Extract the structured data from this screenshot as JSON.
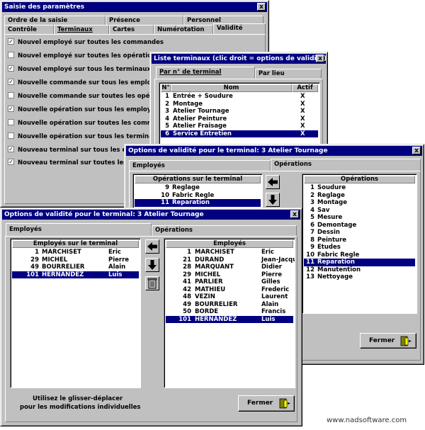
{
  "win1": {
    "title": "Saisie des paramètres",
    "close": "x",
    "tabs_row1": [
      "Ordre de la saisie",
      "Présence",
      "Personnel"
    ],
    "tabs_row2": [
      "Contrôle",
      "Terminaux",
      "Cartes",
      "Numérotation",
      "Validité"
    ],
    "checks": [
      {
        "label": "Nouvel employé sur toutes les commandes",
        "checked": true
      },
      {
        "label": "Nouvel employé sur toutes les opérations",
        "checked": false
      },
      {
        "label": "Nouvel employé sur tous les terminaux",
        "checked": true
      },
      {
        "label": "Nouvelle commande sur tous les employés",
        "checked": true
      },
      {
        "label": "Nouvelle commande sur toutes les opérations",
        "checked": false
      },
      {
        "label": "Nouvelle opération sur tous les employés",
        "checked": true
      },
      {
        "label": "Nouvelle opération sur toutes les commandes",
        "checked": false
      },
      {
        "label": "Nouvelle opération sur tous les terminaux",
        "checked": false
      },
      {
        "label": "Nouveau terminal sur tous les employés",
        "checked": true
      },
      {
        "label": "Nouveau terminal sur toutes les opérations",
        "checked": true
      }
    ]
  },
  "win2": {
    "title": "Liste terminaux  (clic droit = options de validité)",
    "close": "x",
    "tabs": [
      "Par n° de terminal",
      "Par lieu"
    ],
    "headers": [
      "N°",
      "Nom",
      "Actif"
    ],
    "rows": [
      {
        "n": "1",
        "nom": "Entrée + Soudure",
        "actif": "X"
      },
      {
        "n": "2",
        "nom": "Montage",
        "actif": "X"
      },
      {
        "n": "3",
        "nom": "Atelier Tournage",
        "actif": "X"
      },
      {
        "n": "4",
        "nom": "Atelier Peinture",
        "actif": "X"
      },
      {
        "n": "5",
        "nom": "Atelier Fraisage",
        "actif": "X"
      },
      {
        "n": "6",
        "nom": "Service Entretien",
        "actif": "X"
      }
    ]
  },
  "win3": {
    "title": "Options de validité pour le terminal: 3 Atelier Tournage",
    "close": "x",
    "tabs": [
      "Employés",
      "Opérations"
    ],
    "left_header": "Opérations sur le terminal",
    "left_rows": [
      {
        "n": "9",
        "name": "Reglage"
      },
      {
        "n": "10",
        "name": "Fabric Regle"
      },
      {
        "n": "11",
        "name": "Reparation"
      }
    ],
    "right_header": "Opérations",
    "right_rows": [
      {
        "n": "1",
        "name": "Soudure"
      },
      {
        "n": "2",
        "name": "Reglage"
      },
      {
        "n": "3",
        "name": "Montage"
      },
      {
        "n": "4",
        "name": "Sav"
      },
      {
        "n": "5",
        "name": "Mesure"
      },
      {
        "n": "6",
        "name": "Demontage"
      },
      {
        "n": "7",
        "name": "Dessin"
      },
      {
        "n": "8",
        "name": "Peinture"
      },
      {
        "n": "9",
        "name": "Etudes"
      },
      {
        "n": "10",
        "name": "Fabric Regle"
      },
      {
        "n": "11",
        "name": "Reparation"
      },
      {
        "n": "12",
        "name": "Manutention"
      },
      {
        "n": "13",
        "name": "Nettoyage"
      }
    ],
    "close_button": "Fermer"
  },
  "win4": {
    "title": "Options de validité pour le terminal: 3 Atelier Tournage",
    "close": "x",
    "tabs": [
      "Employés",
      "Opérations"
    ],
    "left_header": "Employés sur le terminal",
    "left_rows": [
      {
        "n": "1",
        "name": "MARCHISET",
        "first": "Eric"
      },
      {
        "n": "29",
        "name": "MICHEL",
        "first": "Pierre"
      },
      {
        "n": "49",
        "name": "BOURRELIER",
        "first": "Alain"
      },
      {
        "n": "101",
        "name": "HERNANDEZ",
        "first": "Luis"
      }
    ],
    "right_header": "Employés",
    "right_rows": [
      {
        "n": "1",
        "name": "MARCHISET",
        "first": "Eric"
      },
      {
        "n": "21",
        "name": "DURAND",
        "first": "Jean-Jacqu"
      },
      {
        "n": "28",
        "name": "MARQUANT",
        "first": "Didier"
      },
      {
        "n": "29",
        "name": "MICHEL",
        "first": "Pierre"
      },
      {
        "n": "41",
        "name": "PARLIER",
        "first": "Gilles"
      },
      {
        "n": "42",
        "name": "MATHIEU",
        "first": "Frederic"
      },
      {
        "n": "48",
        "name": "VEZIN",
        "first": "Laurent"
      },
      {
        "n": "49",
        "name": "BOURRELIER",
        "first": "Alain"
      },
      {
        "n": "50",
        "name": "BORDE",
        "first": "Francis"
      },
      {
        "n": "101",
        "name": "HERNANDEZ",
        "first": "Luis"
      }
    ],
    "hint_line1": "Utilisez le glisser-déplacer",
    "hint_line2": "pour les modifications individuelles",
    "close_button": "Fermer"
  },
  "footer": {
    "url": "www.nadsoftware.com"
  }
}
